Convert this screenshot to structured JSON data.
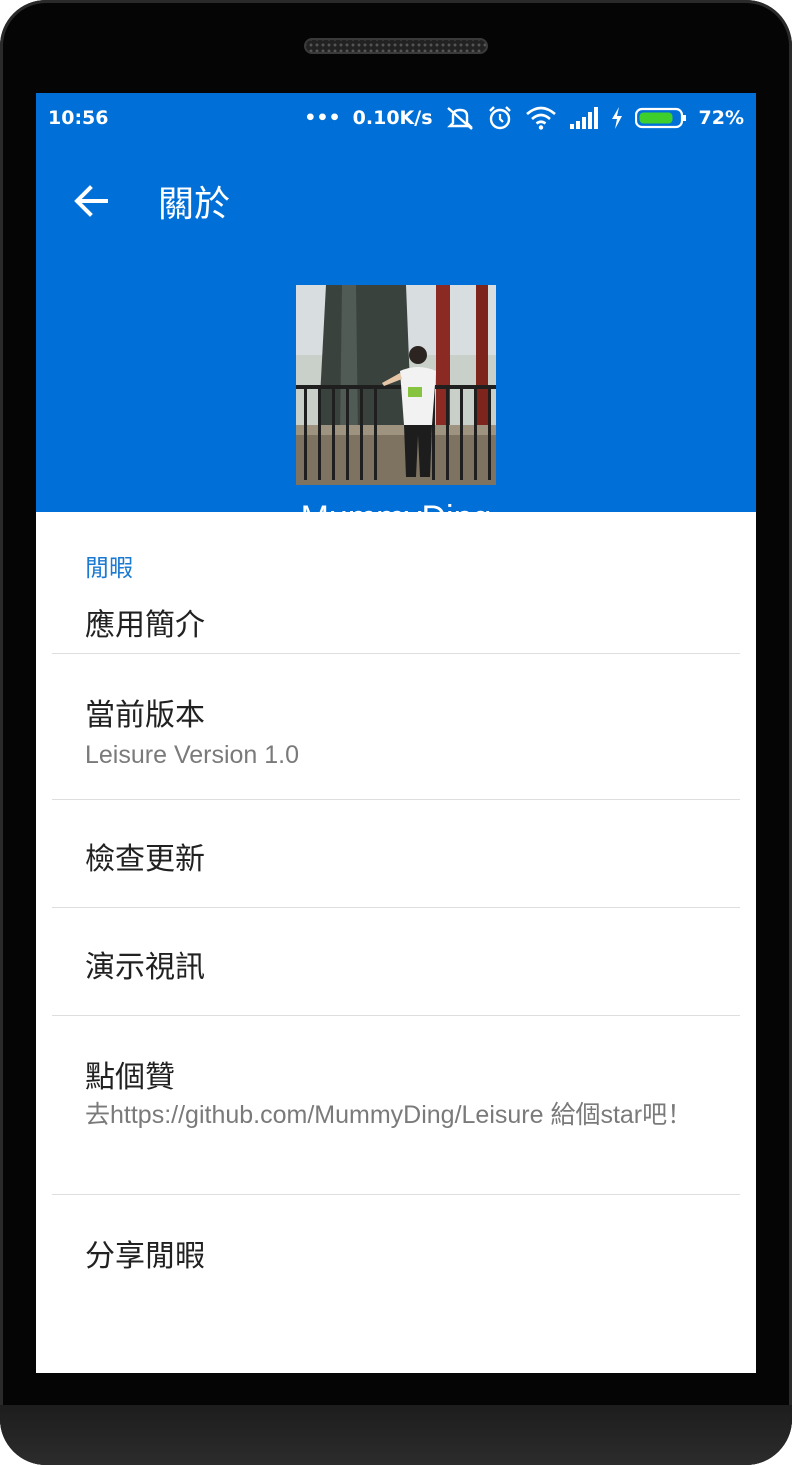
{
  "statusbar": {
    "time": "10:56",
    "network_speed": "0.10K/s",
    "battery_percent": "72%",
    "icons": [
      "dots-icon",
      "silent-icon",
      "alarm-icon",
      "wifi-icon",
      "signal-icon",
      "charging-icon",
      "battery-icon"
    ]
  },
  "toolbar": {
    "title": "關於"
  },
  "profile": {
    "name": "MummyDing"
  },
  "section": {
    "title": "閒暇"
  },
  "items": [
    {
      "label": "應用簡介",
      "summary": ""
    },
    {
      "label": "當前版本",
      "summary": "Leisure Version 1.0"
    },
    {
      "label": "檢查更新",
      "summary": ""
    },
    {
      "label": "演示視訊",
      "summary": ""
    },
    {
      "label": "點個贊",
      "summary": "去https://github.com/MummyDing/Leisure 給個star吧！"
    },
    {
      "label": "分享閒暇",
      "summary": ""
    }
  ],
  "colors": {
    "primary": "#0070d8",
    "accent": "#1a79d0"
  }
}
